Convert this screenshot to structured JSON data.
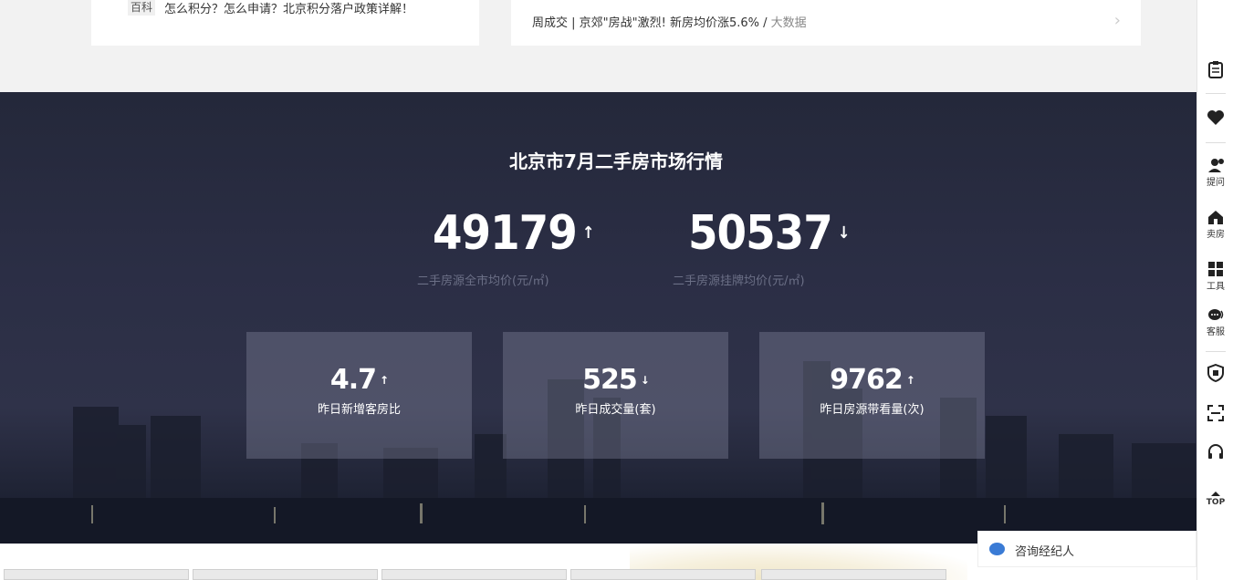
{
  "top_left": {
    "tag": "百科",
    "text": "怎么积分？怎么申请？北京积分落户政策详解！"
  },
  "top_right": {
    "text": "周成交 | 京郊\"房战\"激烈! 新房均价涨5.6% / ",
    "muted": "大数据",
    "chevron": "›"
  },
  "market": {
    "title": "北京市7月二手房市场行情",
    "avg_price": {
      "value": "49179",
      "arrow": "↑",
      "label": "二手房源全市均价(元/㎡)"
    },
    "list_price": {
      "value": "50537",
      "arrow": "↓",
      "label": "二手房源挂牌均价(元/㎡)"
    },
    "stats": [
      {
        "value": "4.7",
        "arrow": "↑",
        "label": "昨日新增客房比"
      },
      {
        "value": "525",
        "arrow": "↓",
        "label": "昨日成交量(套)"
      },
      {
        "value": "9762",
        "arrow": "↑",
        "label": "昨日房源带看量(次)"
      }
    ]
  },
  "sidebar": {
    "items": [
      {
        "icon": "clipboard-icon",
        "label": ""
      },
      {
        "icon": "heart-icon",
        "label": ""
      },
      {
        "icon": "ask-icon",
        "label": "提问"
      },
      {
        "icon": "sell-house-icon",
        "label": "卖房"
      },
      {
        "icon": "tools-icon",
        "label": "工具"
      },
      {
        "icon": "chat-icon",
        "label": "客服"
      },
      {
        "icon": "shield-icon",
        "label": ""
      },
      {
        "icon": "scan-icon",
        "label": ""
      },
      {
        "icon": "headset-icon",
        "label": ""
      },
      {
        "icon": "top-icon",
        "label": "TOP"
      }
    ]
  },
  "consult": {
    "label": "咨询经纪人"
  }
}
